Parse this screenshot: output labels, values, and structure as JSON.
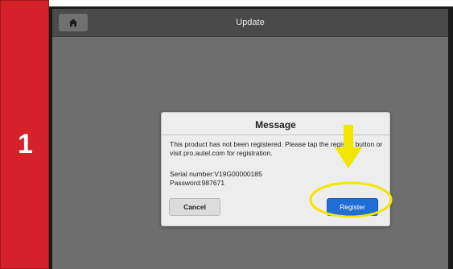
{
  "step": {
    "number": "1"
  },
  "titlebar": {
    "home_icon": "home-icon",
    "title": "Update"
  },
  "dialog": {
    "title": "Message",
    "message": "This product has not been registered. Please tap the register button or visit pro.autel.com for registration.",
    "serial_number": "Serial number:V19G00000185",
    "password": "Password:987671",
    "cancel_label": "Cancel",
    "register_label": "Register"
  },
  "annotation": {
    "arrow_icon": "down-arrow-icon",
    "highlight": "highlight-ellipse",
    "color": "#f2e600"
  },
  "colors": {
    "step_bar": "#d4212a",
    "register_button": "#1f6ed6",
    "screen_bg": "#6e6e6e",
    "titlebar_bg": "#4a4a4a"
  }
}
